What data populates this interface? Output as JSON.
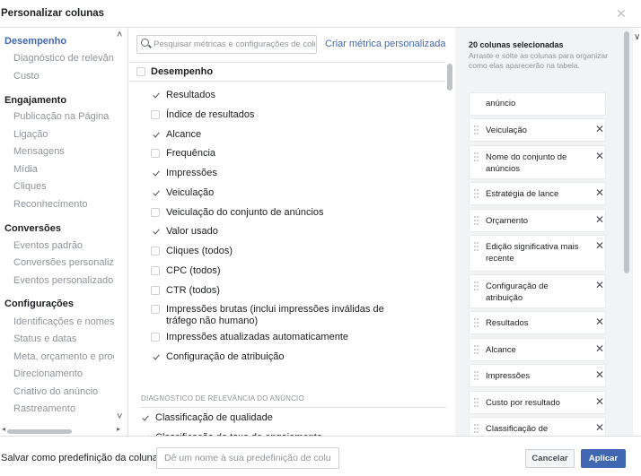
{
  "window": {
    "title": "Personalizar colunas",
    "close_icon": "close-icon"
  },
  "background_peek": {
    "top_label": "∨"
  },
  "nav": {
    "sections": [
      {
        "label": "Desempenho",
        "active": true,
        "items": [
          "Diagnóstico de relevância",
          "Custo"
        ]
      },
      {
        "label": "Engajamento",
        "active": false,
        "items": [
          "Publicação na Página",
          "Ligação",
          "Mensagens",
          "Mídia",
          "Cliques",
          "Reconhecimento"
        ]
      },
      {
        "label": "Conversões",
        "active": false,
        "items": [
          "Eventos padrão",
          "Conversões personalizadas",
          "Eventos personalizados"
        ]
      },
      {
        "label": "Configurações",
        "active": false,
        "items": [
          "Identificações e nomes de objetos",
          "Status e datas",
          "Meta, orçamento e programação",
          "Direcionamento",
          "Criativo do anúncio",
          "Rastreamento"
        ]
      }
    ],
    "scroll_up_icon": "chevron-up-icon",
    "scroll_down_icon": "chevron-down-icon"
  },
  "search": {
    "placeholder": "Pesquisar métricas e configurações de colunas",
    "value": "",
    "icon": "search-icon"
  },
  "custom_metric_link": "Criar métrica personalizada",
  "performance": {
    "header": "Desempenho",
    "header_checked": false,
    "metrics": [
      {
        "label": "Resultados",
        "checked": true
      },
      {
        "label": "Índice de resultados",
        "checked": false
      },
      {
        "label": "Alcance",
        "checked": true
      },
      {
        "label": "Frequência",
        "checked": false
      },
      {
        "label": "Impressões",
        "checked": true
      },
      {
        "label": "Veiculação",
        "checked": true
      },
      {
        "label": "Veiculação do conjunto de anúncios",
        "checked": false
      },
      {
        "label": "Valor usado",
        "checked": true
      },
      {
        "label": "Cliques (todos)",
        "checked": false
      },
      {
        "label": "CPC (todos)",
        "checked": false
      },
      {
        "label": "CTR (todos)",
        "checked": false
      },
      {
        "label": "Impressões brutas (inclui impressões inválidas de tráfego não humano)",
        "checked": false
      },
      {
        "label": "Impressões atualizadas automaticamente",
        "checked": false
      },
      {
        "label": "Configuração de atribuição",
        "checked": true
      }
    ]
  },
  "relevance": {
    "header": "DIAGNÓSTICO DE RELEVÂNCIA DO ANÚNCIO",
    "metrics": [
      {
        "label": "Classificação de qualidade",
        "checked": true
      },
      {
        "label": "Classificação da taxa de engajamento",
        "checked": true
      }
    ]
  },
  "selected": {
    "count_label": "20 colunas selecionadas",
    "hint": "Arraste e solte as colunas para organizar como elas aparecerão na tabela.",
    "items": [
      {
        "label": "anúncio",
        "removable": false
      },
      {
        "label": "Veiculação",
        "removable": true
      },
      {
        "label": "Nome do conjunto de anúncios",
        "removable": true
      },
      {
        "label": "Estratégia de lance",
        "removable": true
      },
      {
        "label": "Orçamento",
        "removable": true
      },
      {
        "label": "Edição significativa mais recente",
        "removable": true
      },
      {
        "label": "Configuração de atribuição",
        "removable": true
      },
      {
        "label": "Resultados",
        "removable": true
      },
      {
        "label": "Alcance",
        "removable": true
      },
      {
        "label": "Impressões",
        "removable": true
      },
      {
        "label": "Custo por resultado",
        "removable": true
      },
      {
        "label": "Classificação de qualidade",
        "removable": true
      }
    ],
    "remove_glyph": "✕"
  },
  "footer": {
    "save_label": "Salvar como predefinição da coluna",
    "preset_placeholder": "Dê um nome à sua predefinição de coluna",
    "cancel_label": "Cancelar",
    "apply_label": "Aplicar"
  },
  "colors": {
    "accent": "#4267b2",
    "border": "#dddfe2",
    "muted": "#90949c",
    "panel_bg": "#f2f3f5"
  }
}
